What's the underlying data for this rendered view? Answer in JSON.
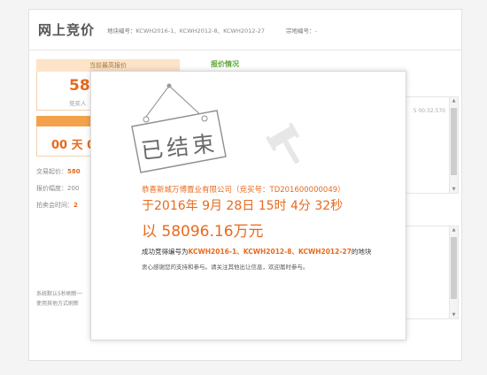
{
  "header": {
    "site_title": "网上竞价",
    "plot_label": "地块编号：",
    "plot_numbers": "KCWH2016-1、KCWH2012-8、KCWH2012-27",
    "parcel_label": "宗地编号：",
    "parcel_value": "-"
  },
  "left": {
    "tab_label": "当前最高报价",
    "price_partial": "580",
    "buyer_partial": "竞买人",
    "countdown_partial": "00 天 0",
    "start_price_label": "交易起价：",
    "start_price_value": "580",
    "increment_label": "报价幅度：",
    "increment_value": "200",
    "start_time_label": "拍卖会时间：",
    "start_time_value": "2",
    "note_line1": "系统默认5秒刷新一",
    "note_line2": "使用其他方式刷新"
  },
  "right": {
    "title": "报价情况",
    "log_time_partial": "5 00:32.570"
  },
  "modal": {
    "sign_text": "已结束",
    "winner_line": "恭喜新城万博置业有限公司（竞买号：TD201600000049）",
    "date_line": "于2016年 9月 28日 15时 4分 32秒",
    "price_line": "以 58096.16万元",
    "success_prefix": "成功竞得编号为",
    "success_plots": "KCWH2016-1、KCWH2012-8、KCWH2012-27",
    "success_suffix": "的地块",
    "thanks_line": "衷心感谢您的支持和参与。请关注其他出让信息，欢迎届时参与。"
  },
  "colors": {
    "accent_orange": "#e8691d",
    "tab_bg": "#fde4c8",
    "green_title": "#5fa838"
  }
}
